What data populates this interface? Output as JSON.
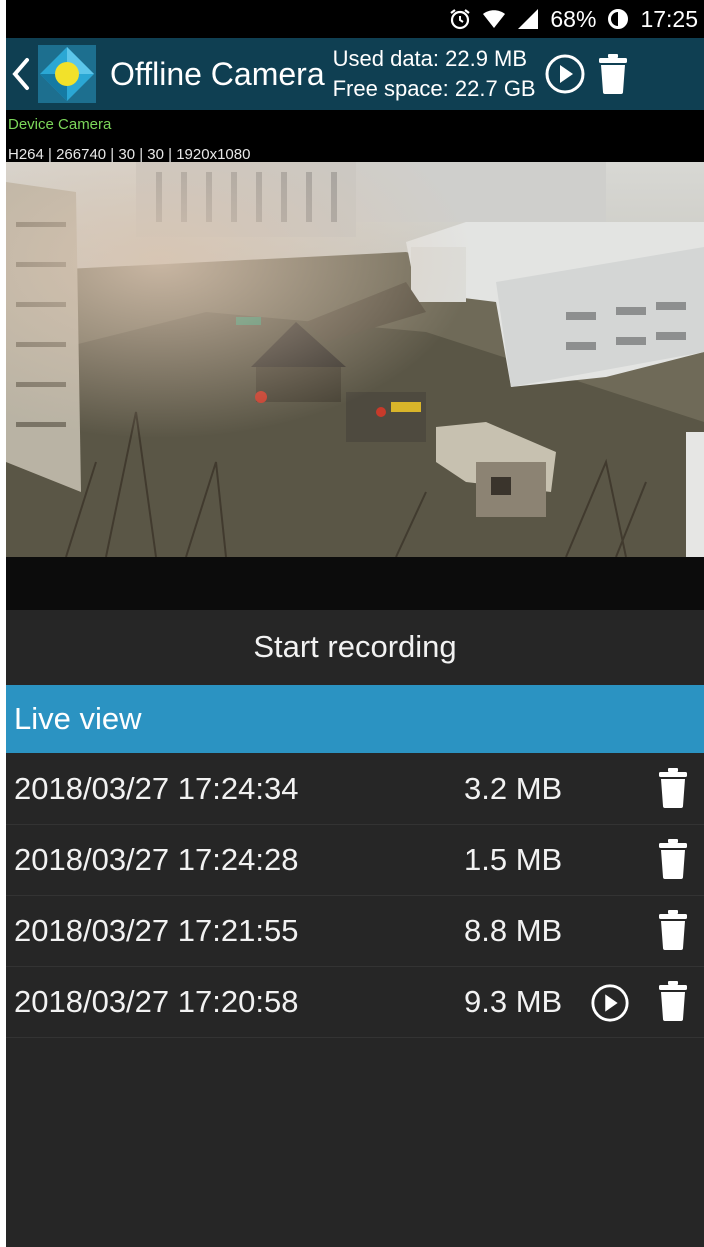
{
  "status_bar": {
    "icons": [
      "alarm-icon",
      "wifi-icon",
      "signal-icon",
      "battery-icon"
    ],
    "battery": "68%",
    "time": "17:25"
  },
  "action_bar": {
    "title": "Offline Camera",
    "used_data": "Used data: 22.9 MB",
    "free_space": "Free space: 22.7 GB",
    "accent": "#0f3f52"
  },
  "camera": {
    "name": "Device Camera",
    "info": "H264 | 266740 | 30 | 30 | 1920x1080"
  },
  "record_button": "Start recording",
  "live_view": {
    "label": "Live view",
    "color": "#2b93c2"
  },
  "recordings": [
    {
      "timestamp": "2018/03/27 17:24:34",
      "size": "3.2 MB",
      "playing": false
    },
    {
      "timestamp": "2018/03/27 17:24:28",
      "size": "1.5 MB",
      "playing": false
    },
    {
      "timestamp": "2018/03/27 17:21:55",
      "size": "8.8 MB",
      "playing": false
    },
    {
      "timestamp": "2018/03/27 17:20:58",
      "size": "9.3 MB",
      "playing": true
    }
  ]
}
